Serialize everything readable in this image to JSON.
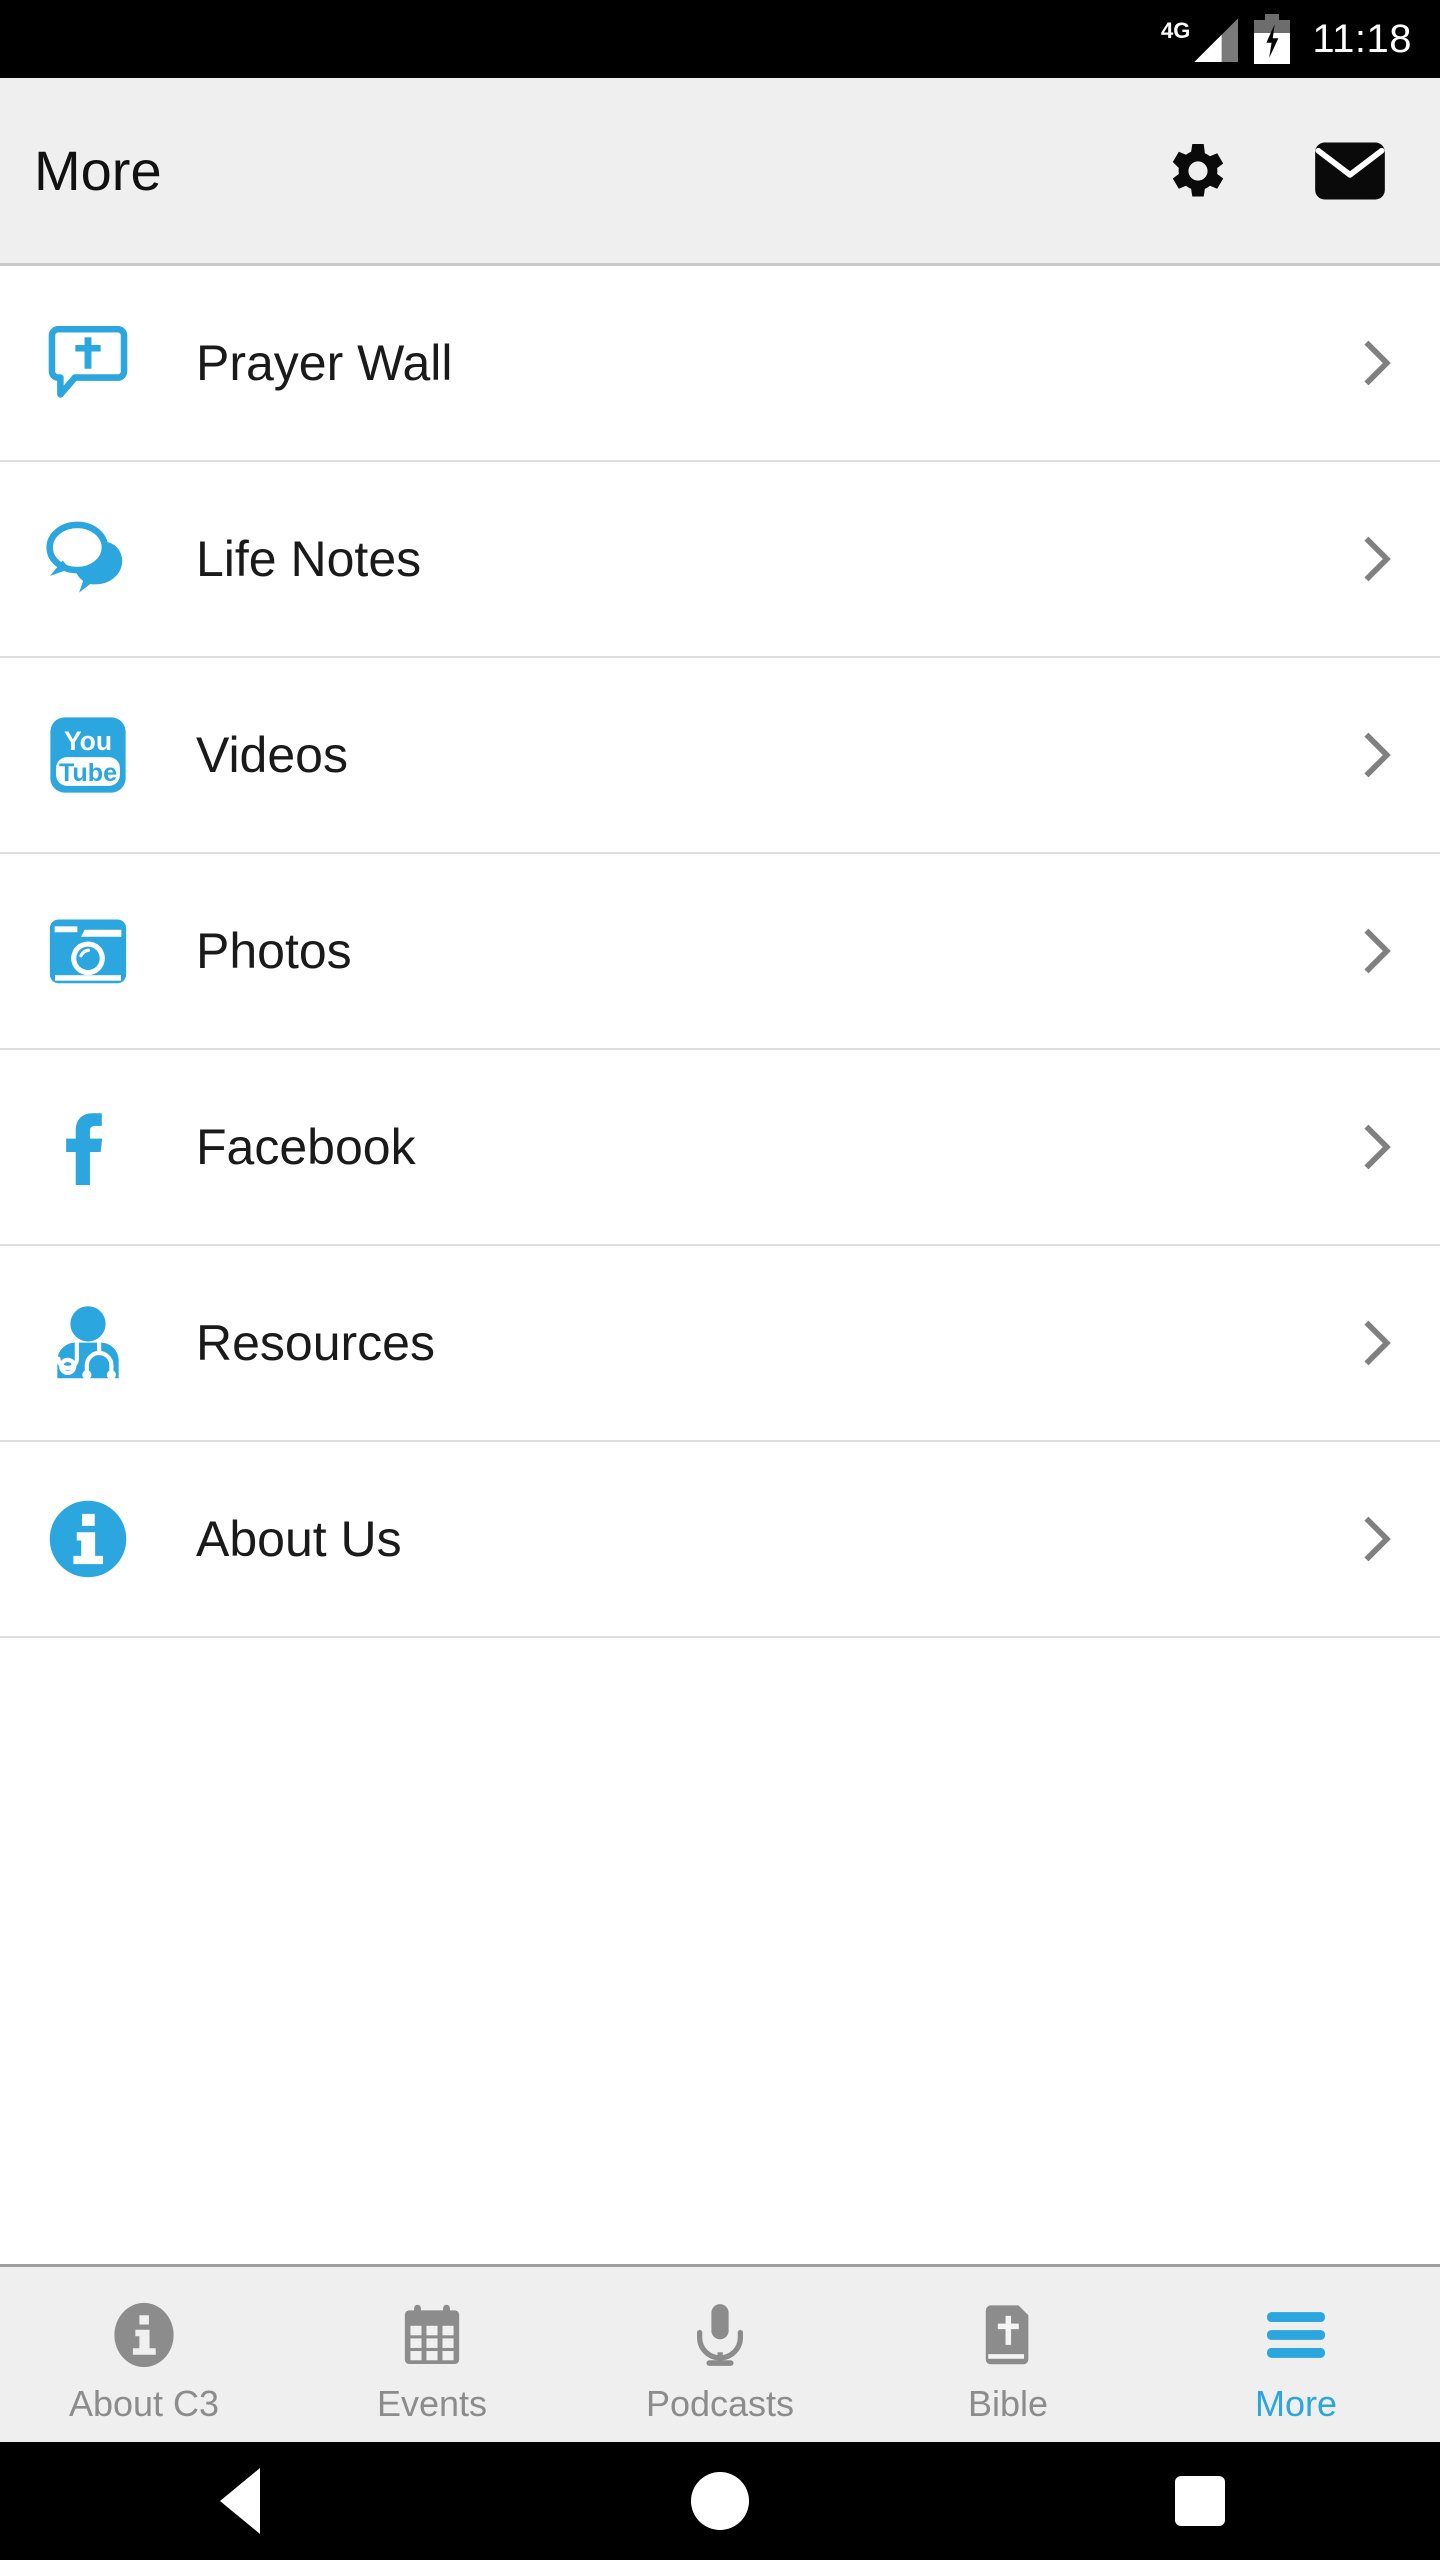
{
  "statusbar": {
    "network_label": "4G",
    "signal_icon": "signal-bars-icon",
    "battery_icon": "battery-charging-icon",
    "time": "11:18"
  },
  "appbar": {
    "title": "More",
    "actions": [
      {
        "name": "settings-button",
        "icon": "gear-icon"
      },
      {
        "name": "mail-button",
        "icon": "envelope-icon"
      }
    ]
  },
  "list": {
    "items": [
      {
        "label": "Prayer Wall",
        "icon": "prayer-bubble-cross-icon",
        "chevron": "chevron-right-icon"
      },
      {
        "label": "Life Notes",
        "icon": "chat-bubbles-icon",
        "chevron": "chevron-right-icon"
      },
      {
        "label": "Videos",
        "icon": "youtube-icon",
        "chevron": "chevron-right-icon"
      },
      {
        "label": "Photos",
        "icon": "camera-icon",
        "chevron": "chevron-right-icon"
      },
      {
        "label": "Facebook",
        "icon": "facebook-icon",
        "chevron": "chevron-right-icon"
      },
      {
        "label": "Resources",
        "icon": "person-stethoscope-icon",
        "chevron": "chevron-right-icon"
      },
      {
        "label": "About Us",
        "icon": "info-circle-icon",
        "chevron": "chevron-right-icon"
      }
    ]
  },
  "tabbar": {
    "tabs": [
      {
        "label": "About C3",
        "icon": "info-circle-icon",
        "active": false
      },
      {
        "label": "Events",
        "icon": "calendar-icon",
        "active": false
      },
      {
        "label": "Podcasts",
        "icon": "microphone-icon",
        "active": false
      },
      {
        "label": "Bible",
        "icon": "book-cross-icon",
        "active": false
      },
      {
        "label": "More",
        "icon": "hamburger-icon",
        "active": true
      }
    ]
  },
  "navbar": {
    "buttons": [
      {
        "name": "back-button",
        "icon": "triangle-back-icon"
      },
      {
        "name": "home-button",
        "icon": "circle-home-icon"
      },
      {
        "name": "recents-button",
        "icon": "square-recents-icon"
      }
    ]
  },
  "colors": {
    "accent": "#2BA6DE",
    "chrome": "#efefef",
    "inactive": "#8c8c8c",
    "chevron": "#808080",
    "separator": "#dedede"
  }
}
